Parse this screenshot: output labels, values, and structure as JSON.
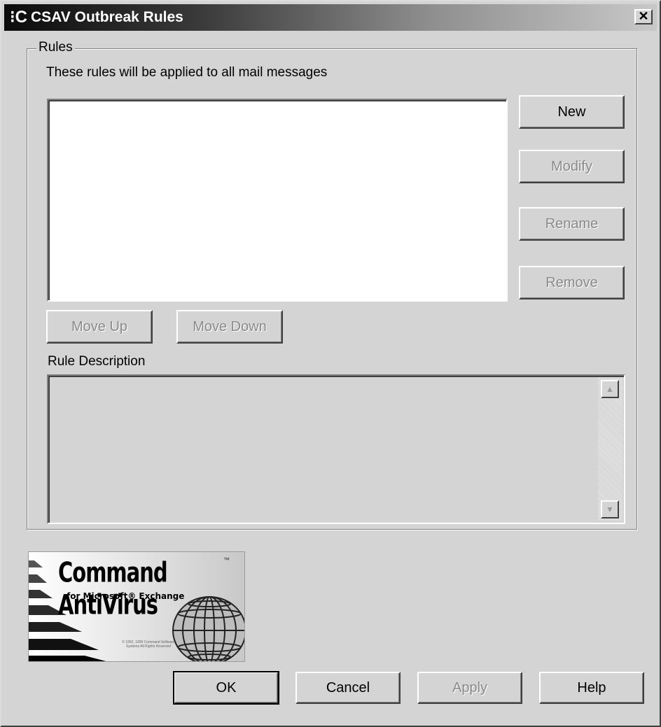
{
  "window": {
    "title": "CSAV Outbreak Rules",
    "icon_glyph": "⁝C",
    "close_glyph": "✕"
  },
  "rules_group": {
    "legend": "Rules",
    "instruction": "These rules will be applied to all mail messages",
    "buttons": {
      "new": "New",
      "modify": "Modify",
      "rename": "Rename",
      "remove": "Remove",
      "move_up": "Move Up",
      "move_down": "Move Down"
    },
    "rule_description_label": "Rule Description"
  },
  "logo": {
    "title": "Command AntiVirus",
    "trademark": "™",
    "subtitle": "for Microsoft® Exchange",
    "copyright": "© 1992, 1999 Command Software Systems All Rights Reserved"
  },
  "footer_buttons": {
    "ok": "OK",
    "cancel": "Cancel",
    "apply": "Apply",
    "help": "Help"
  },
  "scrollbar": {
    "up_glyph": "▲",
    "down_glyph": "▼"
  }
}
